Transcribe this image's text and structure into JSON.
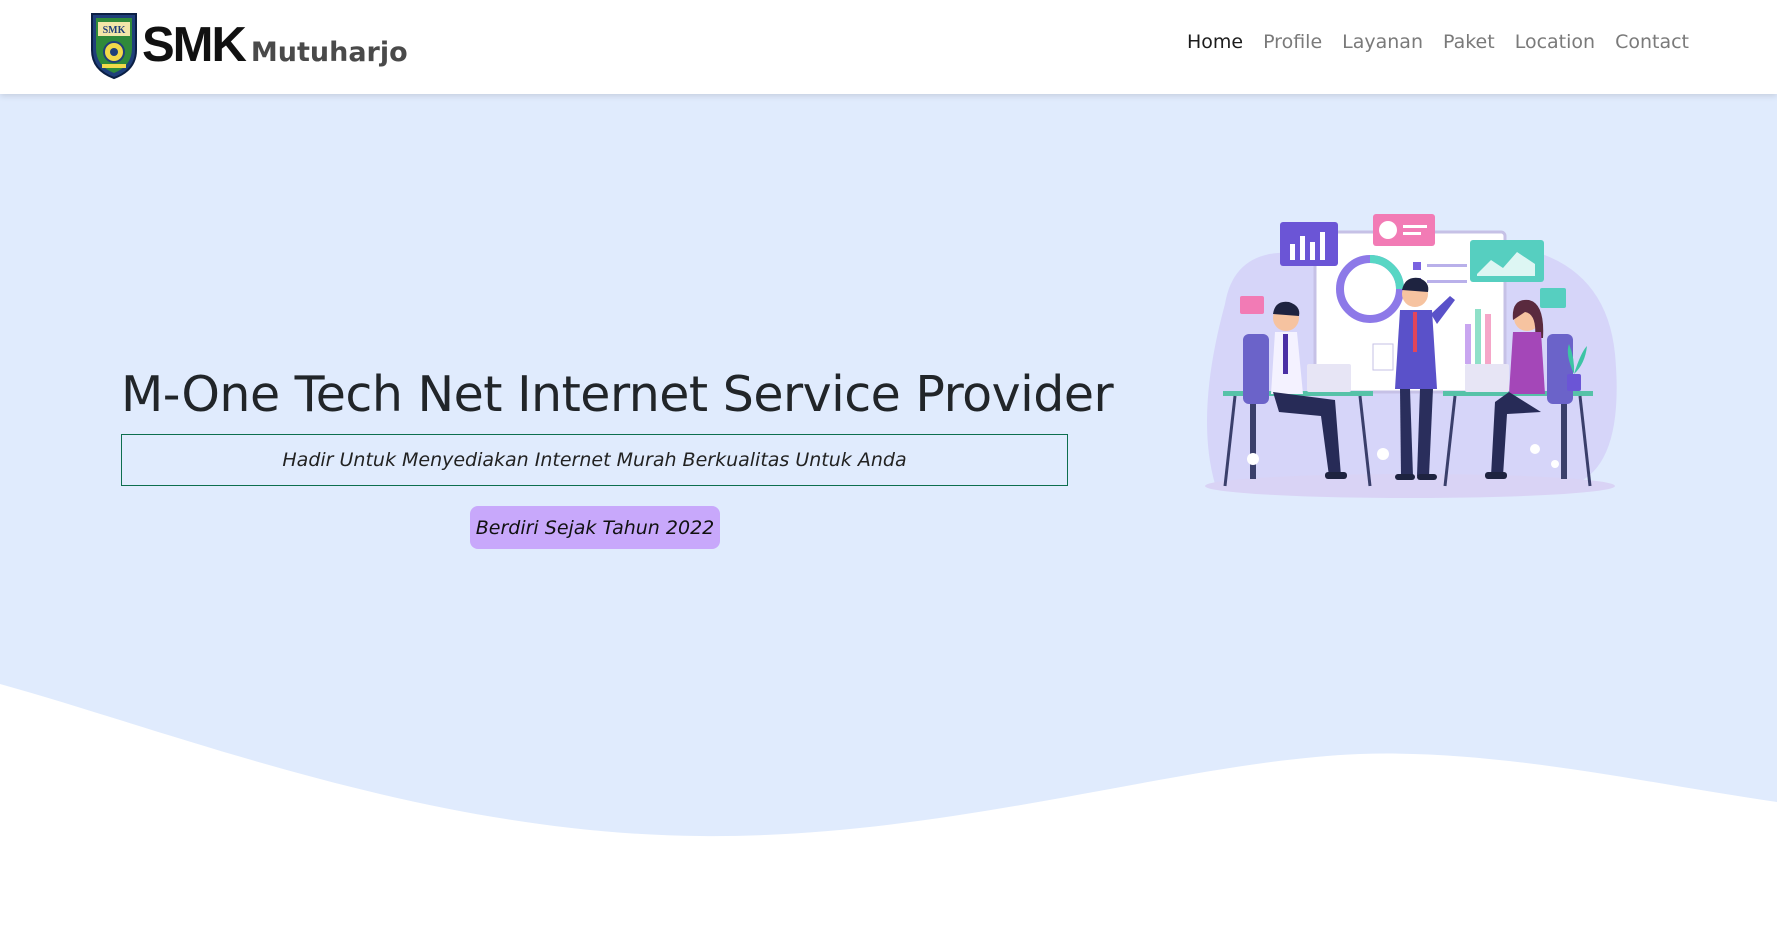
{
  "brand": {
    "logo_icon": "school-crest-icon",
    "emblem_text": "SMK",
    "smk": "SMK",
    "name": "Mutuharjo"
  },
  "nav": {
    "items": [
      {
        "label": "Home",
        "active": true
      },
      {
        "label": "Profile",
        "active": false
      },
      {
        "label": "Layanan",
        "active": false
      },
      {
        "label": "Paket",
        "active": false
      },
      {
        "label": "Location",
        "active": false
      },
      {
        "label": "Contact",
        "active": false
      }
    ]
  },
  "hero": {
    "title": "M-One Tech Net Internet Service Provider",
    "subtitle": "Hadir Untuk Menyediakan Internet Murah Berkualitas Untuk Anda",
    "badge": "Berdiri Sejak Tahun 2022",
    "illustration_icon": "team-presentation-illustration"
  },
  "colors": {
    "hero_background": "#e0ebfd",
    "badge_background": "#c8a8fb",
    "subtitle_border": "#0d6e4e",
    "nav_active": "#1c1c1c",
    "nav_inactive": "#7a7a7a"
  }
}
